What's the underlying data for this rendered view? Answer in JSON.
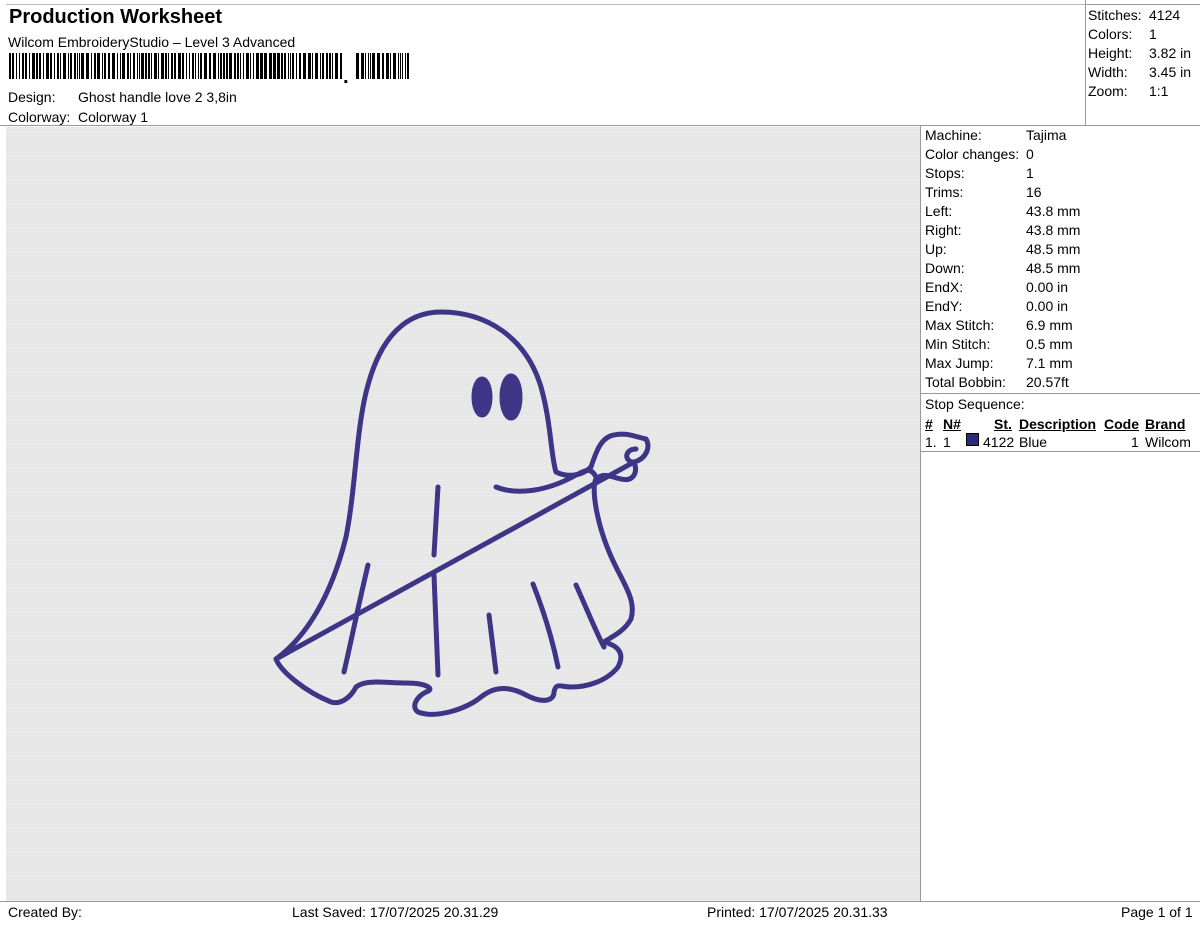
{
  "header": {
    "title": "Production Worksheet",
    "subtitle": "Wilcom EmbroideryStudio – Level 3 Advanced",
    "barcode_icon": "barcode-icon",
    "design_label": "Design:",
    "design_value": "Ghost handle love 2 3,8in",
    "colorway_label": "Colorway:",
    "colorway_value": "Colorway 1"
  },
  "summary": [
    {
      "label": "Stitches:",
      "value": "4124"
    },
    {
      "label": "Colors:",
      "value": "1"
    },
    {
      "label": "Height:",
      "value": "3.82 in"
    },
    {
      "label": "Width:",
      "value": "3.45 in"
    },
    {
      "label": "Zoom:",
      "value": "1:1"
    }
  ],
  "machine_info": [
    {
      "label": "Machine:",
      "value": "Tajima"
    },
    {
      "label": "Color changes:",
      "value": "0"
    },
    {
      "label": "Stops:",
      "value": "1"
    },
    {
      "label": "Trims:",
      "value": "16"
    },
    {
      "label": "Left:",
      "value": "43.8 mm"
    },
    {
      "label": "Right:",
      "value": "43.8 mm"
    },
    {
      "label": "Up:",
      "value": "48.5 mm"
    },
    {
      "label": "Down:",
      "value": "48.5 mm"
    },
    {
      "label": "EndX:",
      "value": "0.00 in"
    },
    {
      "label": "EndY:",
      "value": "0.00 in"
    },
    {
      "label": "Max Stitch:",
      "value": "6.9 mm"
    },
    {
      "label": "Min Stitch:",
      "value": "0.5 mm"
    },
    {
      "label": "Max Jump:",
      "value": "7.1 mm"
    },
    {
      "label": "Total Bobbin:",
      "value": "20.57ft"
    }
  ],
  "stop_sequence": {
    "title": "Stop Sequence:",
    "headers": {
      "num": "#",
      "needle": "N#",
      "stitches": "St.",
      "description": "Description",
      "code": "Code",
      "brand": "Brand"
    },
    "rows": [
      {
        "num": "1.",
        "needle": "1",
        "color": "#2a2a7a",
        "stitches": "4122",
        "description": "Blue",
        "code": "1",
        "brand": "Wilcom"
      }
    ]
  },
  "design_preview": {
    "thread_color": "#3d3585"
  },
  "footer": {
    "created_by": "Created By:",
    "last_saved": "Last Saved: 17/07/2025 20.31.29",
    "printed": "Printed: 17/07/2025 20.31.33",
    "page": "Page 1 of 1"
  }
}
